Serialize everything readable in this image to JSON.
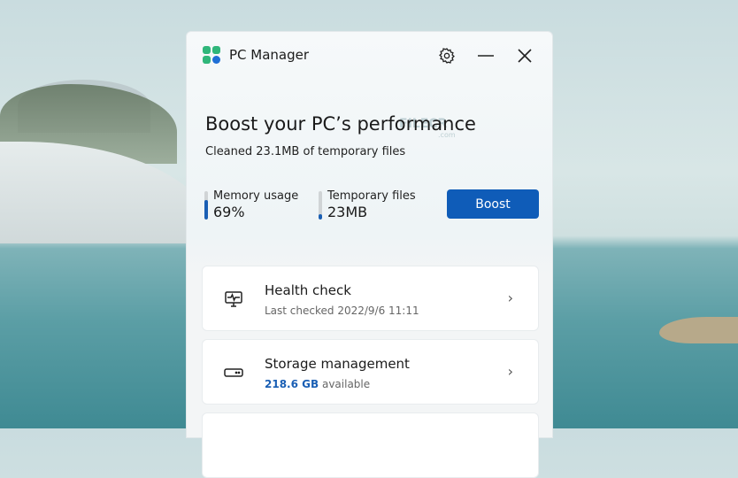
{
  "app": {
    "title": "PC Manager",
    "logo_icon": "pc-manager-logo"
  },
  "window_controls": {
    "settings": "gear-icon",
    "minimize": "minimize-icon",
    "close": "close-icon"
  },
  "hero": {
    "title": "Boost your PC’s performance",
    "subtitle": "Cleaned 23.1MB of temporary files"
  },
  "metrics": [
    {
      "label": "Memory usage",
      "value": "69%",
      "fill_percent": 69
    },
    {
      "label": "Temporary files",
      "value": "23MB",
      "fill_percent": 20
    }
  ],
  "boost_label": "Boost",
  "watermark": {
    "name": "FILECR",
    "suffix": ".com"
  },
  "cards": [
    {
      "title": "Health check",
      "subtitle": "Last checked 2022/9/6 11:11"
    },
    {
      "title": "Storage management",
      "highlight": "218.6 GB",
      "subtitle": "available"
    }
  ],
  "colors": {
    "accent": "#0f5cb8",
    "logo_green": "#2fb67a",
    "logo_blue": "#1f6fd6"
  }
}
